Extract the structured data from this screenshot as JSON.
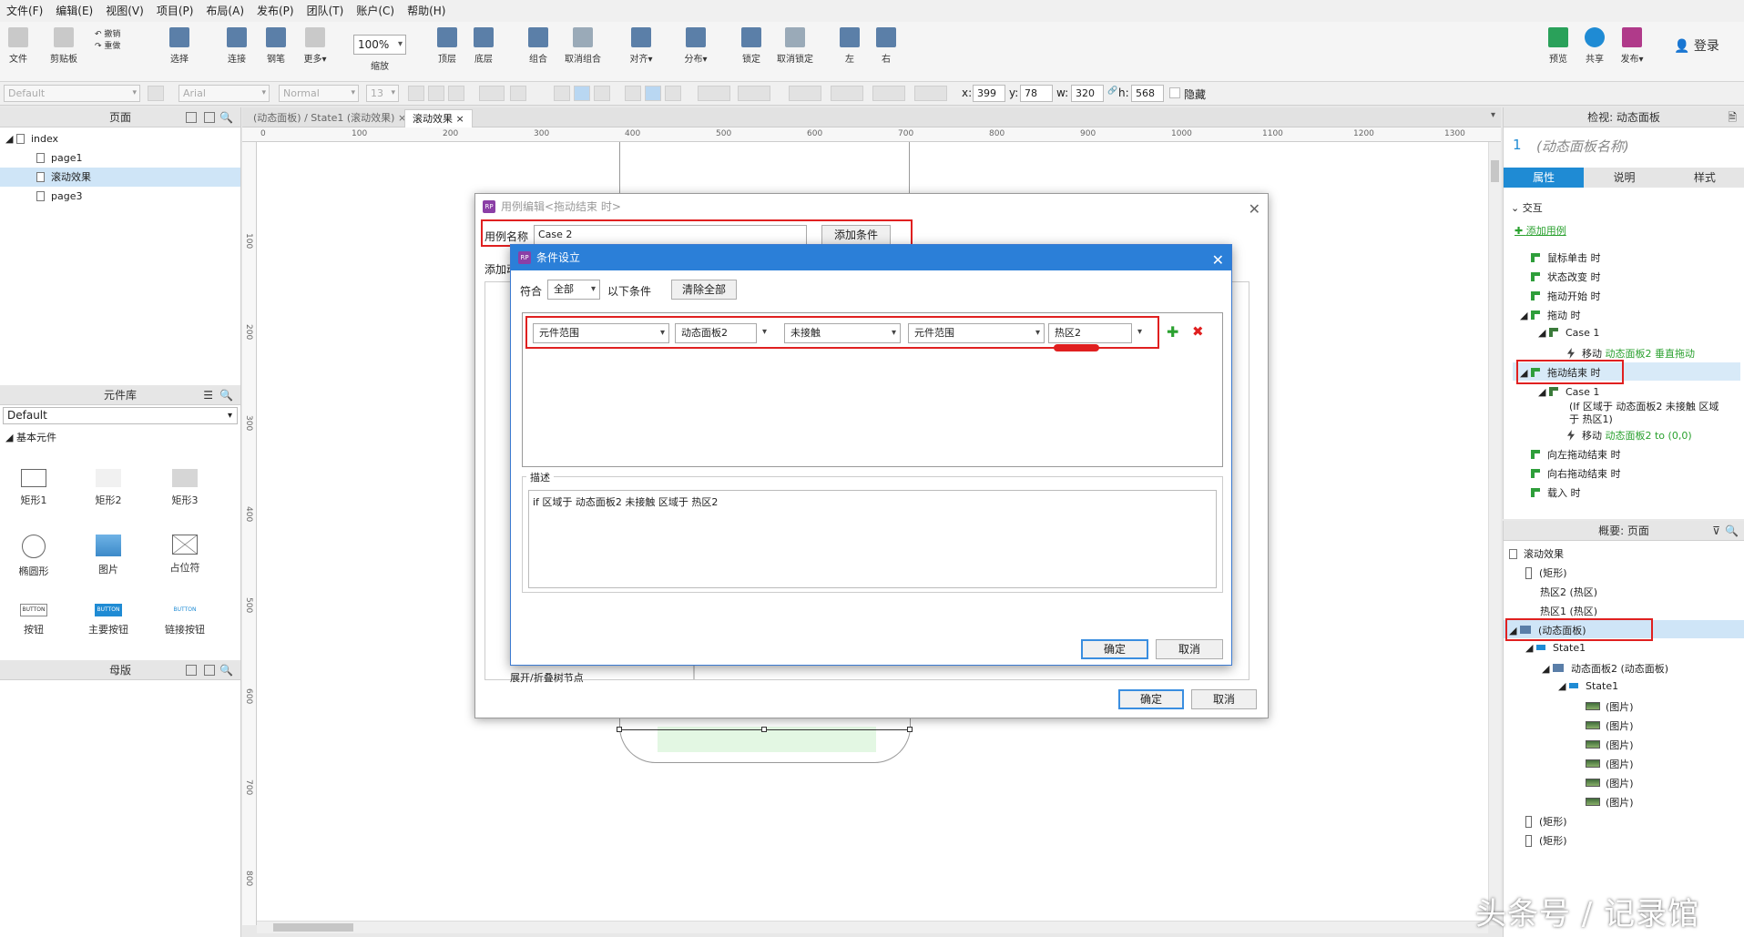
{
  "menu": [
    "文件(F)",
    "编辑(E)",
    "视图(V)",
    "项目(P)",
    "布局(A)",
    "发布(P)",
    "团队(T)",
    "账户(C)",
    "帮助(H)"
  ],
  "toolbar": {
    "file_label": "文件",
    "clipboard_label": "剪贴板",
    "cut": "剪切",
    "undo": "撤销",
    "redo": "重做",
    "select_label": "选择",
    "connect_label": "连接",
    "pen_label": "钢笔",
    "more_label": "更多▾",
    "zoom": "100%",
    "zoom_label": "缩放",
    "top_label": "顶层",
    "bottom_label": "底层",
    "group_label": "组合",
    "ungroup_label": "取消组合",
    "align_label": "对齐▾",
    "distribute_label": "分布▾",
    "lock_label": "锁定",
    "unlock_label": "取消锁定",
    "left_label": "左",
    "right_label": "右",
    "preview_label": "预览",
    "share_label": "共享",
    "publish_label": "发布▾",
    "login": "登录"
  },
  "formatbar": {
    "style": "Default",
    "font": "Arial",
    "weight": "Normal",
    "size": "13",
    "x_label": "x:",
    "x": "399",
    "y_label": "y:",
    "y": "78",
    "w_label": "w:",
    "w": "320",
    "h_label": "h:",
    "h": "568",
    "hidden_label": "隐藏"
  },
  "pages_panel": {
    "title": "页面",
    "items": [
      "index",
      "page1",
      "滚动效果",
      "page3"
    ],
    "selected": "滚动效果"
  },
  "widgets_panel": {
    "title": "元件库",
    "library": "Default",
    "category": "基本元件",
    "items": [
      "矩形1",
      "矩形2",
      "矩形3",
      "椭圆形",
      "图片",
      "占位符",
      "按钮",
      "主要按钮",
      "链接按钮"
    ],
    "button_text": "BUTTON"
  },
  "masters_panel": {
    "title": "母版"
  },
  "canvas": {
    "tabs": [
      "(动态面板) / State1 (滚动效果)",
      "滚动效果"
    ],
    "ruler_top": [
      "0",
      "100",
      "200",
      "300",
      "400",
      "500",
      "600",
      "700",
      "800",
      "900",
      "1000",
      "1100",
      "1200",
      "1300"
    ],
    "ruler_left": [
      "100",
      "200",
      "300",
      "400",
      "500",
      "600",
      "700",
      "800"
    ]
  },
  "inspector": {
    "title": "检视: 动态面板",
    "number": "1",
    "name_placeholder": "(动态面板名称)",
    "tabs": [
      "属性",
      "说明",
      "样式"
    ],
    "section": "交互",
    "add_case": "添加用例",
    "events": {
      "click": "鼠标单击 时",
      "state_change": "状态改变 时",
      "drag_start": "拖动开始 时",
      "drag": "拖动 时",
      "drag_case": "Case 1",
      "drag_action": "移动",
      "drag_action_target": "动态面板2 垂直拖动",
      "drag_end": "拖动结束 时",
      "drag_end_case": "Case 1",
      "drag_end_cond1": "(If 区域于 动态面板2 未接触 区域",
      "drag_end_cond2": "于 热区1)",
      "drag_end_action": "移动",
      "drag_end_action_target": "动态面板2 to (0,0)",
      "swipe_left": "向左拖动结束 时",
      "swipe_right": "向右拖动结束 时",
      "load": "载入 时"
    }
  },
  "outline": {
    "title": "概要: 页面",
    "rows": [
      "滚动效果",
      "(矩形)",
      "热区2 (热区)",
      "热区1 (热区)",
      "(动态面板)",
      "State1",
      "动态面板2 (动态面板)",
      "State1",
      "(图片)",
      "(图片)",
      "(图片)",
      "(图片)",
      "(图片)",
      "(图片)",
      "(矩形)",
      "(矩形)"
    ]
  },
  "case_dialog": {
    "title": "用例编辑<拖动结束 时>",
    "name_label": "用例名称",
    "name_value": "Case 2",
    "add_condition": "添加条件",
    "add_action_label": "添加动",
    "expand_label": "展开/折叠树节点",
    "ok": "确定",
    "cancel": "取消"
  },
  "condition_dialog": {
    "title": "条件设立",
    "match_label": "符合",
    "match_value": "全部",
    "conditions_label": "以下条件",
    "clear_all": "清除全部",
    "row": {
      "left": "元件范围",
      "target": "动态面板2",
      "operator": "未接触",
      "right": "元件范围",
      "value": "热区2"
    },
    "description_label": "描述",
    "description": "if 区域于 动态面板2 未接触 区域于 热区2",
    "ok": "确定",
    "cancel": "取消"
  },
  "watermark": "头条号 / 记录馆",
  "colors": {
    "accent": "#1f8bd4",
    "highlight": "#e02020",
    "green": "#2aa12f",
    "dialog_title": "#2b7fd8"
  }
}
